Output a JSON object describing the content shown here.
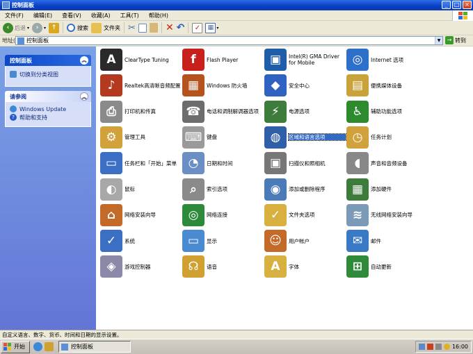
{
  "window": {
    "title": "控制面板"
  },
  "menu": [
    "文件(F)",
    "编辑(E)",
    "查看(V)",
    "收藏(A)",
    "工具(T)",
    "帮助(H)"
  ],
  "toolbar": {
    "back": "后退",
    "search": "搜索",
    "folders": "文件夹"
  },
  "address": {
    "label": "地址(D)",
    "value": "控制面板",
    "go": "转到"
  },
  "left": {
    "panel1": {
      "title": "控制面板",
      "link": "切换到分类视图"
    },
    "panel2": {
      "title": "请参阅",
      "links": [
        "Windows Update",
        "帮助和支持"
      ]
    }
  },
  "items": [
    {
      "label": "ClearType Tuning",
      "icon": "cleartype-icon",
      "color": "#2a2a2a",
      "glyph": "A"
    },
    {
      "label": "Flash Player",
      "icon": "flash-icon",
      "color": "#c8201a",
      "glyph": "f"
    },
    {
      "label": "Intel(R) GMA Driver for Mobile",
      "icon": "intel-gma-icon",
      "color": "#1f5da8",
      "glyph": "▣"
    },
    {
      "label": "Internet 选项",
      "icon": "internet-options-icon",
      "color": "#2d6fc9",
      "glyph": "◎"
    },
    {
      "label": "Realtek高清晰音频配置",
      "icon": "realtek-audio-icon",
      "color": "#b33a1f",
      "glyph": "♪"
    },
    {
      "label": "Windows 防火墙",
      "icon": "firewall-icon",
      "color": "#b5521d",
      "glyph": "▦"
    },
    {
      "label": "安全中心",
      "icon": "security-center-icon",
      "color": "#2f62c1",
      "glyph": "◆"
    },
    {
      "label": "便携媒体设备",
      "icon": "portable-media-icon",
      "color": "#c9a23a",
      "glyph": "▤"
    },
    {
      "label": "打印机和传真",
      "icon": "printer-icon",
      "color": "#8a8a8a",
      "glyph": "⎙"
    },
    {
      "label": "电话和调制解调器选项",
      "icon": "phone-modem-icon",
      "color": "#6d6d6d",
      "glyph": "☎"
    },
    {
      "label": "电源选项",
      "icon": "power-icon",
      "color": "#3d7c3a",
      "glyph": "⚡"
    },
    {
      "label": "辅助功能选项",
      "icon": "accessibility-icon",
      "color": "#2d8a2d",
      "glyph": "♿"
    },
    {
      "label": "管理工具",
      "icon": "admin-tools-icon",
      "color": "#d1a23c",
      "glyph": "⚙"
    },
    {
      "label": "键盘",
      "icon": "keyboard-icon",
      "color": "#9a9a9a",
      "glyph": "⌨"
    },
    {
      "label": "区域和语言选项",
      "icon": "region-language-icon",
      "color": "#2f5fa8",
      "glyph": "◍"
    },
    {
      "label": "任务计划",
      "icon": "scheduled-tasks-icon",
      "color": "#d1a23c",
      "glyph": "◷"
    },
    {
      "label": "任务栏和「开始」菜单",
      "icon": "taskbar-start-icon",
      "color": "#3a6fc4",
      "glyph": "▭"
    },
    {
      "label": "日期和时间",
      "icon": "date-time-icon",
      "color": "#6b8fc4",
      "glyph": "◔"
    },
    {
      "label": "扫描仪和照相机",
      "icon": "scanner-camera-icon",
      "color": "#777777",
      "glyph": "▣"
    },
    {
      "label": "声音和音频设备",
      "icon": "sound-icon",
      "color": "#888888",
      "glyph": "◖"
    },
    {
      "label": "鼠标",
      "icon": "mouse-icon",
      "color": "#a8a8a8",
      "glyph": "◐"
    },
    {
      "label": "索引选项",
      "icon": "indexing-icon",
      "color": "#8a8a8a",
      "glyph": "⌕"
    },
    {
      "label": "添加或删除程序",
      "icon": "add-remove-programs-icon",
      "color": "#4a7ab8",
      "glyph": "◉"
    },
    {
      "label": "添加硬件",
      "icon": "add-hardware-icon",
      "color": "#3d7c3a",
      "glyph": "▦"
    },
    {
      "label": "网络安装向导",
      "icon": "network-setup-icon",
      "color": "#c46a28",
      "glyph": "⌂"
    },
    {
      "label": "网络连接",
      "icon": "network-connections-icon",
      "color": "#2d8a3a",
      "glyph": "◎"
    },
    {
      "label": "文件夹选项",
      "icon": "folder-options-icon",
      "color": "#d8b040",
      "glyph": "✓"
    },
    {
      "label": "无线网络安装向导",
      "icon": "wireless-setup-icon",
      "color": "#7a9ab8",
      "glyph": "≋"
    },
    {
      "label": "系统",
      "icon": "system-icon",
      "color": "#3a6fc4",
      "glyph": "✓"
    },
    {
      "label": "显示",
      "icon": "display-icon",
      "color": "#4a8ad0",
      "glyph": "▭"
    },
    {
      "label": "用户帐户",
      "icon": "user-accounts-icon",
      "color": "#c46a28",
      "glyph": "☺"
    },
    {
      "label": "邮件",
      "icon": "mail-icon",
      "color": "#3a7ac4",
      "glyph": "✉"
    },
    {
      "label": "游戏控制器",
      "icon": "game-controller-icon",
      "color": "#8a8aa8",
      "glyph": "◈"
    },
    {
      "label": "语音",
      "icon": "speech-icon",
      "color": "#d0a030",
      "glyph": "☊"
    },
    {
      "label": "字体",
      "icon": "fonts-icon",
      "color": "#d8b040",
      "glyph": "A"
    },
    {
      "label": "自动更新",
      "icon": "automatic-updates-icon",
      "color": "#2f8a3a",
      "glyph": "⊞"
    }
  ],
  "selected_item": "区域和语言选项",
  "status": "自定义语言、数字、货币、时间和日期的显示设置。",
  "taskbar": {
    "start": "开始",
    "task": "控制面板",
    "clock": "16:00"
  }
}
